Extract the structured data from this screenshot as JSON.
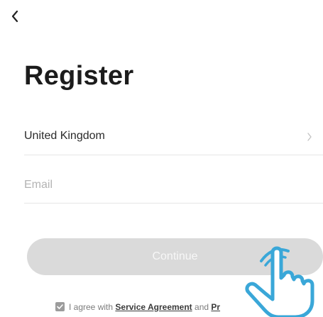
{
  "header": {
    "back_icon": "chevron-left-icon"
  },
  "page": {
    "title": "Register"
  },
  "form": {
    "country": {
      "value": "United Kingdom",
      "icon": "chevron-right-icon"
    },
    "email": {
      "value": "",
      "placeholder": "Email"
    },
    "continue_label": "Continue",
    "continue_enabled": false
  },
  "agreement": {
    "checked": true,
    "prefix": "I agree with",
    "service_agreement": "Service Agreement",
    "conjunction": "and",
    "privacy_policy": "Pr"
  },
  "overlay": {
    "icon": "pointing-hand-icon",
    "color": "#3aa7d8"
  },
  "colors": {
    "title": "#1c1c1c",
    "button_disabled_bg": "#dadada",
    "button_disabled_text": "#f7f7f7",
    "divider": "#e6e6e6"
  }
}
